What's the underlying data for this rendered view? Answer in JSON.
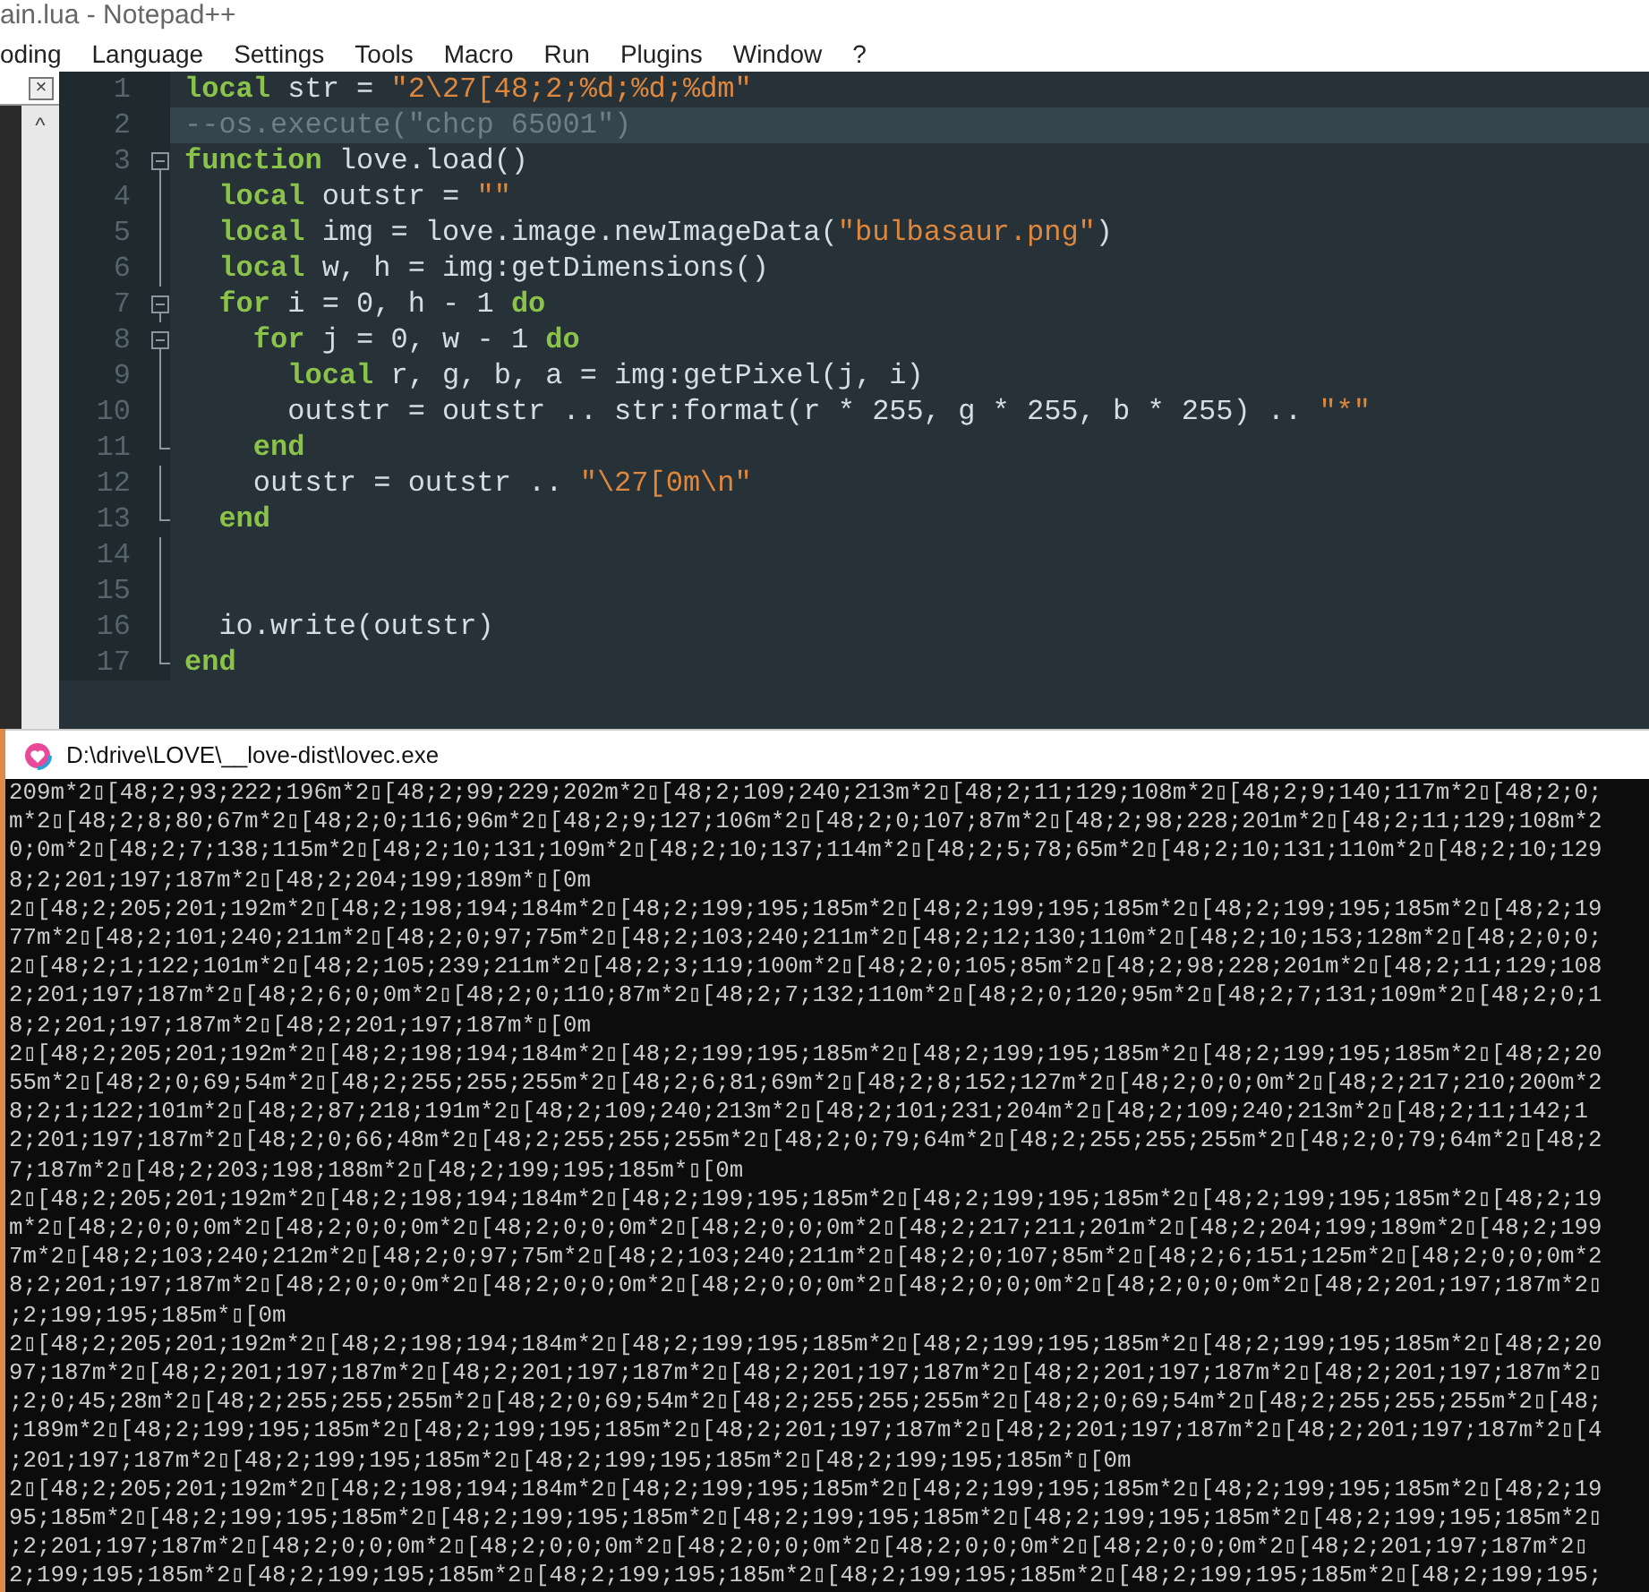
{
  "window": {
    "title": "ain.lua - Notepad++"
  },
  "menu": [
    "oding",
    "Language",
    "Settings",
    "Tools",
    "Macro",
    "Run",
    "Plugins",
    "Window",
    "?"
  ],
  "side_panel": {
    "close": "×",
    "scroll": "^"
  },
  "editor": {
    "lines": [
      {
        "number": "1",
        "current": false,
        "fold_start": false,
        "fold_end": false,
        "tokens": [
          {
            "kind": "keyword",
            "text": "local"
          },
          {
            "kind": "plain",
            "text": " str = "
          },
          {
            "kind": "string",
            "text": "\"2\\27[48;2;%d;%d;%dm\""
          }
        ]
      },
      {
        "number": "2",
        "current": true,
        "fold_start": false,
        "fold_end": false,
        "tokens": [
          {
            "kind": "comment",
            "text": "--os.execute(\"chcp 65001\")"
          }
        ]
      },
      {
        "number": "3",
        "current": false,
        "fold_start": true,
        "fold_end": false,
        "tokens": [
          {
            "kind": "keyword",
            "text": "function"
          },
          {
            "kind": "plain",
            "text": " love.load()"
          }
        ]
      },
      {
        "number": "4",
        "current": false,
        "fold_start": false,
        "fold_end": false,
        "tokens": [
          {
            "kind": "keyword",
            "text": "local"
          },
          {
            "kind": "plain",
            "text": " outstr = "
          },
          {
            "kind": "string",
            "text": "\"\""
          }
        ]
      },
      {
        "number": "5",
        "current": false,
        "fold_start": false,
        "fold_end": false,
        "tokens": [
          {
            "kind": "keyword",
            "text": "local"
          },
          {
            "kind": "plain",
            "text": " img = love.image.newImageData("
          },
          {
            "kind": "string",
            "text": "\"bulbasaur.png\""
          },
          {
            "kind": "plain",
            "text": ")"
          }
        ]
      },
      {
        "number": "6",
        "current": false,
        "fold_start": false,
        "fold_end": false,
        "tokens": [
          {
            "kind": "keyword",
            "text": "local"
          },
          {
            "kind": "plain",
            "text": " w, h = img:getDimensions()"
          }
        ]
      },
      {
        "number": "7",
        "current": false,
        "fold_start": true,
        "fold_end": false,
        "tokens": [
          {
            "kind": "keyword",
            "text": "for"
          },
          {
            "kind": "plain",
            "text": " i = 0, h - 1 "
          },
          {
            "kind": "keyword",
            "text": "do"
          }
        ]
      },
      {
        "number": "8",
        "current": false,
        "fold_start": true,
        "fold_end": false,
        "tokens": [
          {
            "kind": "keyword",
            "text": "for"
          },
          {
            "kind": "plain",
            "text": " j = 0, w - 1 "
          },
          {
            "kind": "keyword",
            "text": "do"
          }
        ]
      },
      {
        "number": "9",
        "current": false,
        "fold_start": false,
        "fold_end": false,
        "tokens": [
          {
            "kind": "keyword",
            "text": "local"
          },
          {
            "kind": "plain",
            "text": " r, g, b, a = img:getPixel(j, i)"
          }
        ]
      },
      {
        "number": "10",
        "current": false,
        "fold_start": false,
        "fold_end": false,
        "tokens": [
          {
            "kind": "plain",
            "text": "outstr = outstr .. str:format(r * 255, g * 255, b * 255) .. "
          },
          {
            "kind": "string",
            "text": "\"*\""
          }
        ]
      },
      {
        "number": "11",
        "current": false,
        "fold_start": false,
        "fold_end": true,
        "tokens": [
          {
            "kind": "keyword",
            "text": "end"
          }
        ]
      },
      {
        "number": "12",
        "current": false,
        "fold_start": false,
        "fold_end": false,
        "tokens": [
          {
            "kind": "plain",
            "text": "outstr = outstr .. "
          },
          {
            "kind": "string",
            "text": "\"\\27[0m\\n\""
          }
        ]
      },
      {
        "number": "13",
        "current": false,
        "fold_start": false,
        "fold_end": true,
        "tokens": [
          {
            "kind": "keyword",
            "text": "end"
          }
        ]
      },
      {
        "number": "14",
        "current": false,
        "fold_start": false,
        "fold_end": false
      },
      {
        "number": "15",
        "current": false,
        "fold_start": false,
        "fold_end": false
      },
      {
        "number": "16",
        "current": false,
        "fold_start": false,
        "fold_end": false,
        "tokens": [
          {
            "kind": "plain",
            "text": "io.write(outstr)"
          }
        ]
      },
      {
        "number": "17",
        "current": false,
        "fold_start": false,
        "fold_end": true,
        "tokens": [
          {
            "kind": "keyword",
            "text": "end"
          }
        ]
      }
    ]
  },
  "console": {
    "title": "D:\\drive\\LOVE\\__love-dist\\lovec.exe",
    "lines": [
      "209m*2▯[48;2;93;222;196m*2▯[48;2;99;229;202m*2▯[48;2;109;240;213m*2▯[48;2;11;129;108m*2▯[48;2;9;140;117m*2▯[48;2;0;",
      "m*2▯[48;2;8;80;67m*2▯[48;2;0;116;96m*2▯[48;2;9;127;106m*2▯[48;2;0;107;87m*2▯[48;2;98;228;201m*2▯[48;2;11;129;108m*2",
      "0;0m*2▯[48;2;7;138;115m*2▯[48;2;10;131;109m*2▯[48;2;10;137;114m*2▯[48;2;5;78;65m*2▯[48;2;10;131;110m*2▯[48;2;10;129",
      "8;2;201;197;187m*2▯[48;2;204;199;189m*▯[0m",
      "2▯[48;2;205;201;192m*2▯[48;2;198;194;184m*2▯[48;2;199;195;185m*2▯[48;2;199;195;185m*2▯[48;2;199;195;185m*2▯[48;2;19",
      "77m*2▯[48;2;101;240;211m*2▯[48;2;0;97;75m*2▯[48;2;103;240;211m*2▯[48;2;12;130;110m*2▯[48;2;10;153;128m*2▯[48;2;0;0;",
      "2▯[48;2;1;122;101m*2▯[48;2;105;239;211m*2▯[48;2;3;119;100m*2▯[48;2;0;105;85m*2▯[48;2;98;228;201m*2▯[48;2;11;129;108",
      "2;201;197;187m*2▯[48;2;6;0;0m*2▯[48;2;0;110;87m*2▯[48;2;7;132;110m*2▯[48;2;0;120;95m*2▯[48;2;7;131;109m*2▯[48;2;0;1",
      "8;2;201;197;187m*2▯[48;2;201;197;187m*▯[0m",
      "2▯[48;2;205;201;192m*2▯[48;2;198;194;184m*2▯[48;2;199;195;185m*2▯[48;2;199;195;185m*2▯[48;2;199;195;185m*2▯[48;2;20",
      "55m*2▯[48;2;0;69;54m*2▯[48;2;255;255;255m*2▯[48;2;6;81;69m*2▯[48;2;8;152;127m*2▯[48;2;0;0;0m*2▯[48;2;217;210;200m*2",
      "8;2;1;122;101m*2▯[48;2;87;218;191m*2▯[48;2;109;240;213m*2▯[48;2;101;231;204m*2▯[48;2;109;240;213m*2▯[48;2;11;142;1",
      "2;201;197;187m*2▯[48;2;0;66;48m*2▯[48;2;255;255;255m*2▯[48;2;0;79;64m*2▯[48;2;255;255;255m*2▯[48;2;0;79;64m*2▯[48;2",
      "7;187m*2▯[48;2;203;198;188m*2▯[48;2;199;195;185m*▯[0m",
      "2▯[48;2;205;201;192m*2▯[48;2;198;194;184m*2▯[48;2;199;195;185m*2▯[48;2;199;195;185m*2▯[48;2;199;195;185m*2▯[48;2;19",
      "m*2▯[48;2;0;0;0m*2▯[48;2;0;0;0m*2▯[48;2;0;0;0m*2▯[48;2;0;0;0m*2▯[48;2;217;211;201m*2▯[48;2;204;199;189m*2▯[48;2;199",
      "7m*2▯[48;2;103;240;212m*2▯[48;2;0;97;75m*2▯[48;2;103;240;211m*2▯[48;2;0;107;85m*2▯[48;2;6;151;125m*2▯[48;2;0;0;0m*2",
      "8;2;201;197;187m*2▯[48;2;0;0;0m*2▯[48;2;0;0;0m*2▯[48;2;0;0;0m*2▯[48;2;0;0;0m*2▯[48;2;0;0;0m*2▯[48;2;201;197;187m*2▯",
      ";2;199;195;185m*▯[0m",
      "2▯[48;2;205;201;192m*2▯[48;2;198;194;184m*2▯[48;2;199;195;185m*2▯[48;2;199;195;185m*2▯[48;2;199;195;185m*2▯[48;2;20",
      "97;187m*2▯[48;2;201;197;187m*2▯[48;2;201;197;187m*2▯[48;2;201;197;187m*2▯[48;2;201;197;187m*2▯[48;2;201;197;187m*2▯",
      ";2;0;45;28m*2▯[48;2;255;255;255m*2▯[48;2;0;69;54m*2▯[48;2;255;255;255m*2▯[48;2;0;69;54m*2▯[48;2;255;255;255m*2▯[48;",
      ";189m*2▯[48;2;199;195;185m*2▯[48;2;199;195;185m*2▯[48;2;201;197;187m*2▯[48;2;201;197;187m*2▯[48;2;201;197;187m*2▯[4",
      ";201;197;187m*2▯[48;2;199;195;185m*2▯[48;2;199;195;185m*2▯[48;2;199;195;185m*▯[0m",
      "2▯[48;2;205;201;192m*2▯[48;2;198;194;184m*2▯[48;2;199;195;185m*2▯[48;2;199;195;185m*2▯[48;2;199;195;185m*2▯[48;2;19",
      "95;185m*2▯[48;2;199;195;185m*2▯[48;2;199;195;185m*2▯[48;2;199;195;185m*2▯[48;2;199;195;185m*2▯[48;2;199;195;185m*2▯",
      ";2;201;197;187m*2▯[48;2;0;0;0m*2▯[48;2;0;0;0m*2▯[48;2;0;0;0m*2▯[48;2;0;0;0m*2▯[48;2;0;0;0m*2▯[48;2;201;197;187m*2▯",
      "2;199;195;185m*2▯[48;2;199;195;185m*2▯[48;2;199;195;185m*2▯[48;2;199;195;185m*2▯[48;2;199;195;185m*2▯[48;2;199;195;"
    ]
  }
}
